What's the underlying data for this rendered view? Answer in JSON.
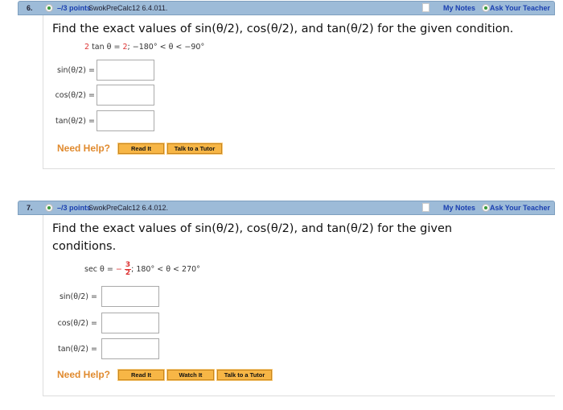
{
  "questions": [
    {
      "number": "6.",
      "points": "–/3 points",
      "source": "SwokPreCalc12 6.4.011.",
      "my_notes": "My Notes",
      "ask_teacher": "Ask Your Teacher",
      "prompt": "Find the exact values of sin(θ/2), cos(θ/2), and tan(θ/2) for the given condition.",
      "condition": {
        "coef": "2",
        "expr": " tan θ = ",
        "value": "2",
        "range": ";    −180° < θ < −90°"
      },
      "fields": [
        {
          "label": "sin(θ/2) =",
          "value": ""
        },
        {
          "label": "cos(θ/2) =",
          "value": ""
        },
        {
          "label": "tan(θ/2) =",
          "value": ""
        }
      ],
      "need_help": "Need Help?",
      "buttons": [
        "Read It",
        "Talk to a Tutor"
      ]
    },
    {
      "number": "7.",
      "points": "–/3 points",
      "source": "SwokPreCalc12 6.4.012.",
      "my_notes": "My Notes",
      "ask_teacher": "Ask Your Teacher",
      "prompt": "Find the exact values of sin(θ/2), cos(θ/2), and tan(θ/2) for the given conditions.",
      "condition": {
        "expr": "sec θ = ",
        "sign": "−",
        "numerator": "3",
        "denominator": "2",
        "range": ";    180° < θ < 270°"
      },
      "fields": [
        {
          "label": "sin(θ/2)  =",
          "value": ""
        },
        {
          "label": "cos(θ/2)  =",
          "value": ""
        },
        {
          "label": "tan(θ/2)  =",
          "value": ""
        }
      ],
      "need_help": "Need Help?",
      "buttons": [
        "Read It",
        "Watch It",
        "Talk to a Tutor"
      ]
    }
  ]
}
